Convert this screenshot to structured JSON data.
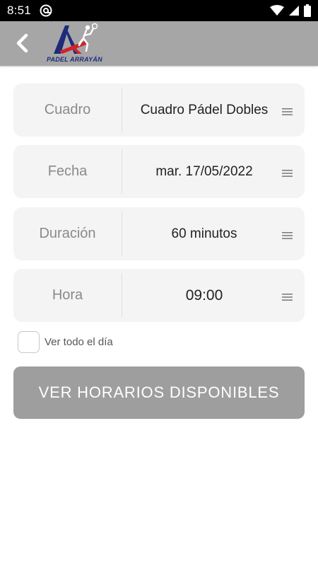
{
  "status_bar": {
    "time": "8:51",
    "icons": [
      "at-sign-icon",
      "wifi-icon",
      "signal-icon",
      "battery-icon"
    ]
  },
  "header": {
    "logo_text": "PADEL ARRAYÁN",
    "back_icon": "chevron-left-icon",
    "background": "#a6a6a6"
  },
  "form": {
    "fields": [
      {
        "label": "Cuadro",
        "value": "Cuadro Pádel Dobles"
      },
      {
        "label": "Fecha",
        "value": "mar. 17/05/2022"
      },
      {
        "label": "Duración",
        "value": "60 minutos"
      },
      {
        "label": "Hora",
        "value": "09:00"
      }
    ],
    "checkbox_label": "Ver todo el día",
    "checkbox_checked": false,
    "submit_label": "VER HORARIOS DISPONIBLES"
  },
  "colors": {
    "field_background": "#f4f4f4",
    "button_background": "#9e9e9e",
    "logo_blue": "#1d2b7a",
    "logo_red": "#d2232a"
  }
}
